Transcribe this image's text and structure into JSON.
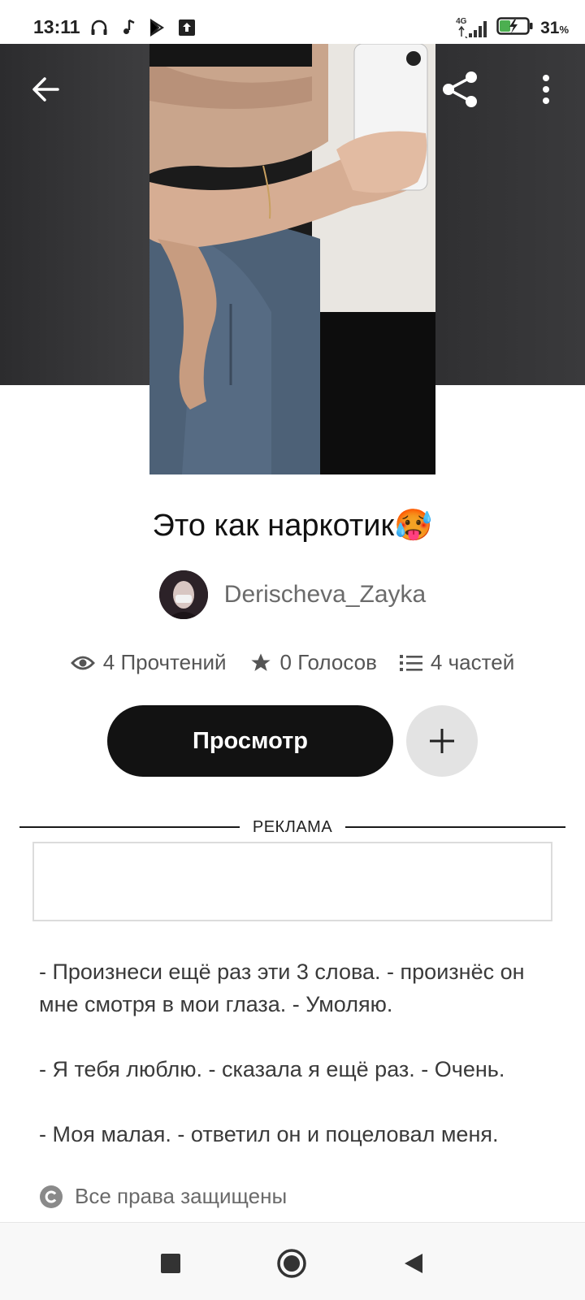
{
  "status_bar": {
    "time": "13:11",
    "network": "4G",
    "battery_percent": "31",
    "battery_unit": "%"
  },
  "header": {
    "back_icon": "arrow-left-icon",
    "share_icon": "share-icon",
    "more_icon": "more-vertical-icon"
  },
  "story": {
    "title": "Это как наркотик🥵",
    "author": "Derischeva_Zayka",
    "stats": {
      "reads": "4 Прочтений",
      "votes": "0 Голосов",
      "parts": "4 частей"
    },
    "read_button": "Просмотр",
    "ad_label": "РЕКЛАМА",
    "paragraphs": [
      "- Произнеси ещё раз эти 3 слова. - произнёс он мне смотря в мои глаза. - Умоляю.",
      "- Я тебя люблю. - сказала я ещё раз. - Очень.",
      "- Моя малая. - ответил он и поцеловал меня."
    ],
    "copyright": "Все права защищены"
  },
  "colors": {
    "primary_button": "#121212",
    "secondary_button": "#e3e3e3",
    "text_muted": "#6b6b6b"
  }
}
